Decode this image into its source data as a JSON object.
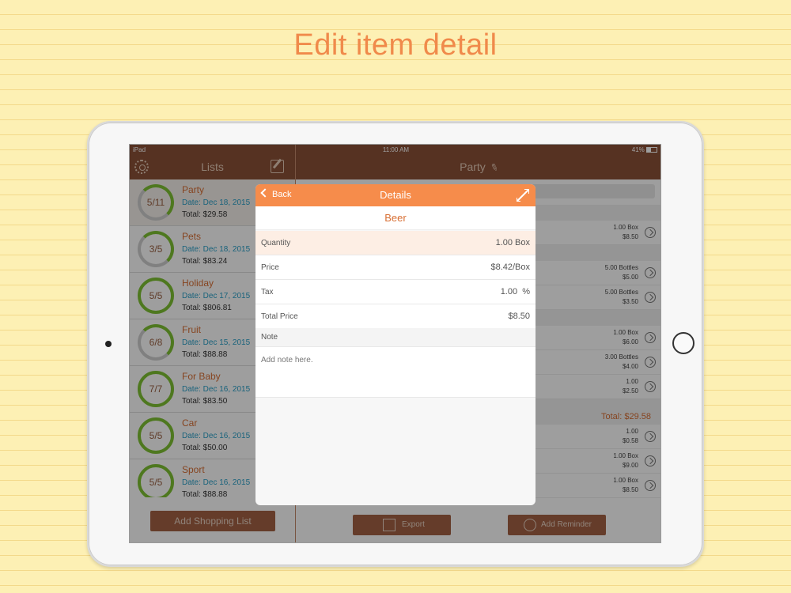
{
  "page": {
    "headline": "Edit item detail"
  },
  "statusbar": {
    "carrier": "iPad",
    "time": "11:00 AM",
    "battery": "41%"
  },
  "lists_pane": {
    "title": "Lists",
    "items": [
      {
        "progress": "5/11",
        "name": "Party",
        "date": "Date: Dec 18, 2015",
        "total": "Total: $29.58",
        "complete_fraction": 0.45
      },
      {
        "progress": "3/5",
        "name": "Pets",
        "date": "Date: Dec 18, 2015",
        "total": "Total: $83.24",
        "complete_fraction": 0.6
      },
      {
        "progress": "5/5",
        "name": "Holiday",
        "date": "Date: Dec 17, 2015",
        "total": "Total: $806.81",
        "complete_fraction": 1.0
      },
      {
        "progress": "6/8",
        "name": "Fruit",
        "date": "Date: Dec 15, 2015",
        "total": "Total: $88.88",
        "complete_fraction": 0.75
      },
      {
        "progress": "7/7",
        "name": "For Baby",
        "date": "Date: Dec 16, 2015",
        "total": "Total: $83.50",
        "complete_fraction": 1.0
      },
      {
        "progress": "5/5",
        "name": "Car",
        "date": "Date: Dec 16, 2015",
        "total": "Total: $50.00",
        "complete_fraction": 1.0
      },
      {
        "progress": "5/5",
        "name": "Sport",
        "date": "Date: Dec 16, 2015",
        "total": "Total: $88.88",
        "complete_fraction": 1.0
      }
    ],
    "add_button": "Add Shopping List"
  },
  "detail_pane": {
    "title": "Party",
    "rows": [
      {
        "qty": "1.00 Box",
        "price": "$8.50"
      },
      {
        "qty": "5.00 Bottles",
        "price": "$5.00"
      },
      {
        "qty": "5.00 Bottles",
        "price": "$3.50"
      },
      {
        "qty": "1.00 Box",
        "price": "$6.00"
      },
      {
        "qty": "3.00 Bottles",
        "price": "$4.00"
      },
      {
        "qty": "1.00",
        "price": "$2.50"
      },
      {
        "qty": "1.00",
        "price": "$0.58"
      },
      {
        "qty": "1.00 Box",
        "price": "$9.00"
      },
      {
        "qty": "1.00 Box",
        "price": "$8.50"
      }
    ],
    "total": "Total: $29.58",
    "export_button": "Export",
    "reminder_button": "Add Reminder"
  },
  "modal": {
    "back": "Back",
    "title": "Details",
    "item_name": "Beer",
    "fields": [
      {
        "label": "Quantity",
        "value": "1.00 Box"
      },
      {
        "label": "Price",
        "value": "$8.42/Box"
      },
      {
        "label": "Tax",
        "value": "1.00  %"
      },
      {
        "label": "Total Price",
        "value": "$8.50"
      }
    ],
    "note_label": "Note",
    "note_placeholder": "Add note here."
  }
}
